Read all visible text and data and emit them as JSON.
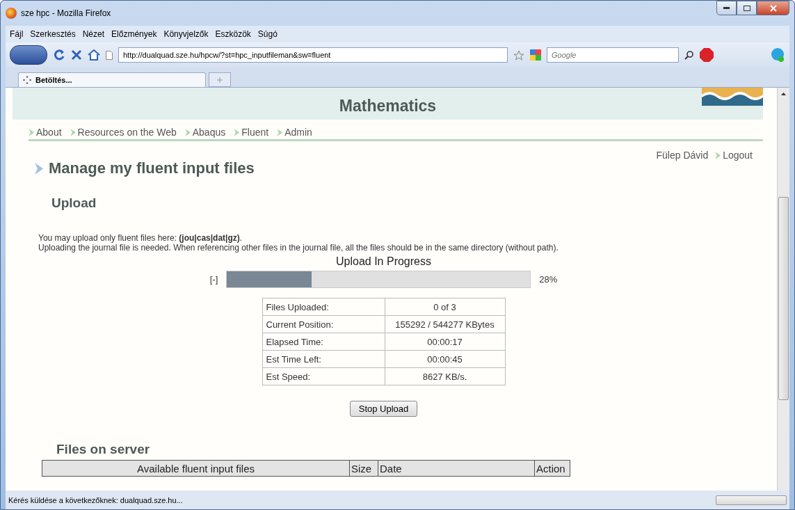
{
  "window": {
    "title": "sze hpc - Mozilla Firefox"
  },
  "menu": [
    "Fájl",
    "Szerkesztés",
    "Nézet",
    "Előzmények",
    "Könyvjelzők",
    "Eszközök",
    "Súgó"
  ],
  "address": {
    "value": "http://dualquad.sze.hu/hpcw/?st=hpc_inputfileman&sw=fluent"
  },
  "search": {
    "placeholder": "Google"
  },
  "tabs": [
    {
      "label": "Betöltés...",
      "selected": true
    }
  ],
  "site": {
    "header_title": "Mathematics",
    "nav": [
      "About",
      "Resources on the Web",
      "Abaqus",
      "Fluent",
      "Admin"
    ],
    "user": "Fülep Dávid",
    "logout": "Logout"
  },
  "page_title": "Manage my fluent input files",
  "upload": {
    "heading": "Upload",
    "note1": "You may upload only fluent files here: **(jou|cas|dat|gz)**.",
    "note2": "Uploading the journal file is needed. When referencing other files in the journal file, all the files should be in the same directory (without path).",
    "progress_title": "Upload In Progress",
    "toggle": "[-]",
    "level": 0.28,
    "percent": "28%",
    "stats": [
      {
        "label": "Files Uploaded:",
        "value": "0 of 3"
      },
      {
        "label": "Current Position:",
        "value": "155292 / 544277 KBytes"
      },
      {
        "label": "Elapsed Time:",
        "value": "00:00:17"
      },
      {
        "label": "Est Time Left:",
        "value": "00:00:45"
      },
      {
        "label": "Est Speed:",
        "value": "8627 KB/s."
      }
    ],
    "stop_button": "Stop Upload"
  },
  "files": {
    "heading": "Files on server",
    "columns": [
      "Available fluent input files",
      "Size",
      "Date",
      "Action"
    ]
  },
  "status_progress": {
    "level": 0
  },
  "status_bar": "Kérés küldése a következőknek: dualquad.sze.hu..."
}
